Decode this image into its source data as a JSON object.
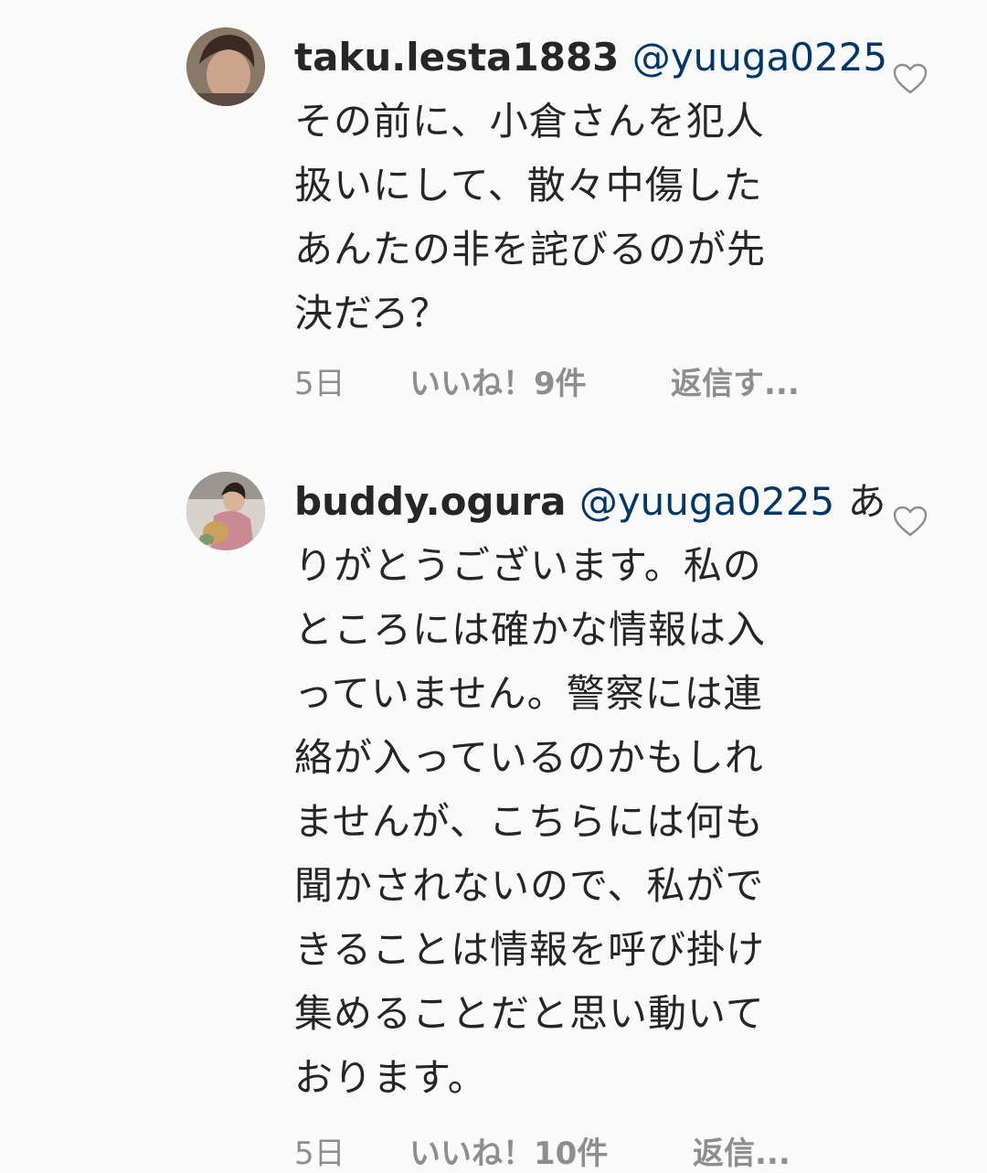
{
  "comments": [
    {
      "username": "taku.lesta1883",
      "mention": "@yuuga0225",
      "first_line_rest": "",
      "lines": [
        "その前に、小倉さんを犯人",
        "扱いにして、散々中傷した",
        "あんたの非を詫びるのが先",
        "決だろ？"
      ],
      "time": "5日",
      "likes": "いいね！9件",
      "reply": "返信す..."
    },
    {
      "username": "buddy.ogura",
      "mention": "@yuuga0225",
      "first_line_rest": " あ",
      "lines": [
        "りがとうございます。私の",
        "ところには確かな情報は入",
        "っていません。警察には連",
        "絡が入っているのかもしれ",
        "ませんが、こちらには何も",
        "聞かされないので、私がで",
        "きることは情報を呼び掛け",
        "集めることだと思い動いて",
        "おります。"
      ],
      "time": "5日",
      "likes": "いいね！10件",
      "reply": "返信..."
    }
  ],
  "icons": {
    "like": "heart-outline-icon"
  },
  "colors": {
    "mention": "#00376b",
    "meta": "#8e8e8e",
    "text": "#262626",
    "background": "#fafafa"
  }
}
